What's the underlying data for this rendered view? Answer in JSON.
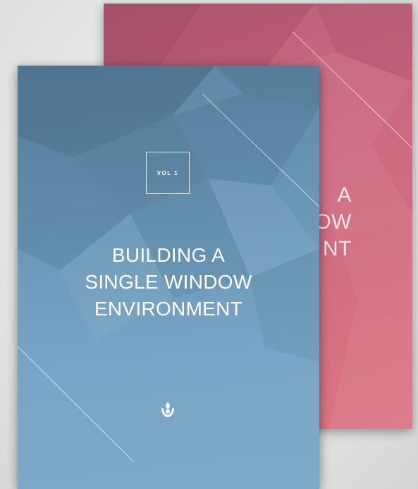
{
  "front_cover": {
    "volume_label": "VOL 1",
    "title": "BUILDING A\nSINGLE WINDOW\nENVIRONMENT",
    "background_color": "#6a96b6",
    "logo_icon": "wco-emblem-icon"
  },
  "back_cover": {
    "visible_title_fragment": "A\nOW\nNT",
    "background_color": "#cc6a80"
  }
}
